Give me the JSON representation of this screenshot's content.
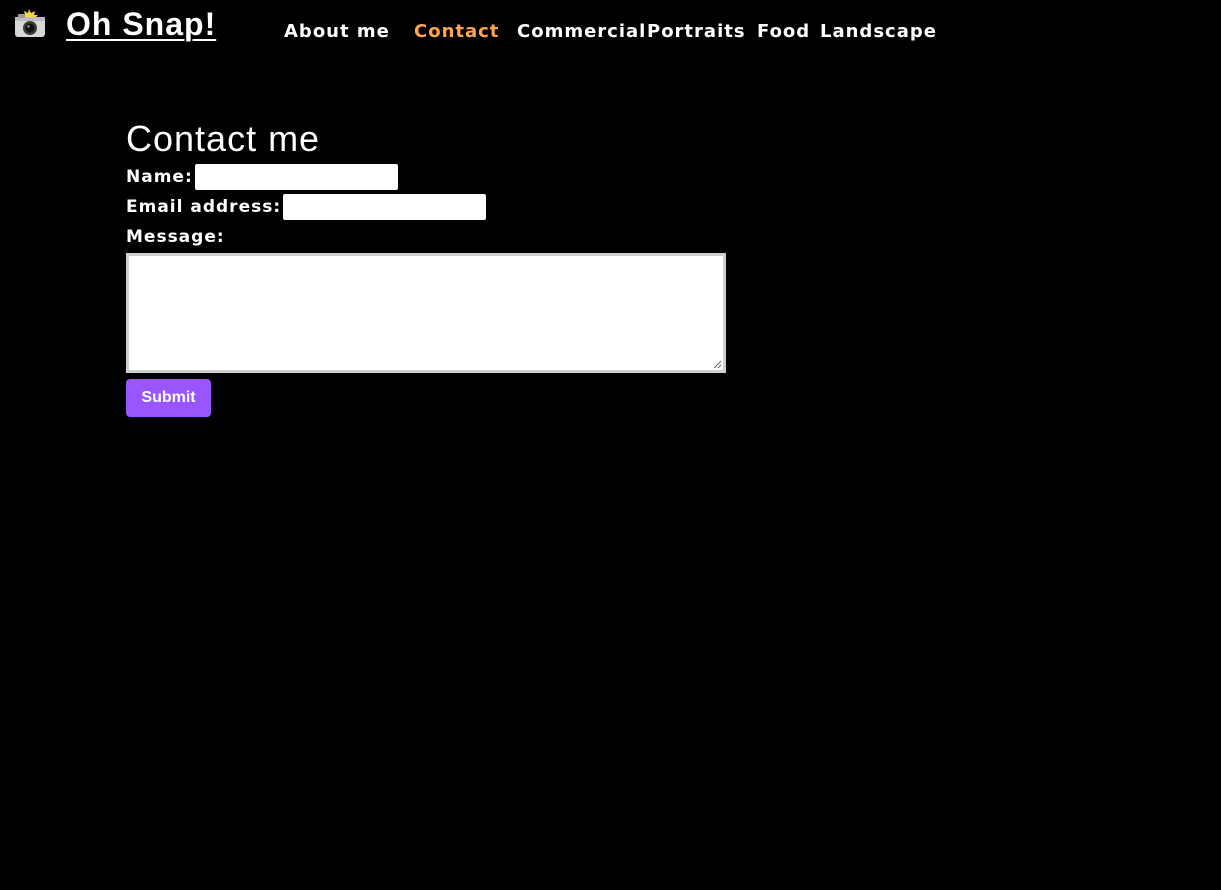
{
  "site": {
    "brand_icon": "camera-flash-icon",
    "brand_name": "Oh Snap!"
  },
  "nav": {
    "items": [
      {
        "label": "About me",
        "active": false
      },
      {
        "label": "Contact",
        "active": true
      },
      {
        "label": "Commercial",
        "active": false
      },
      {
        "label": "Portraits",
        "active": false
      },
      {
        "label": "Food",
        "active": false
      },
      {
        "label": "Landscape",
        "active": false
      }
    ]
  },
  "contact_form": {
    "title": "Contact me",
    "name_label": "Name:",
    "name_value": "",
    "email_label": "Email address:",
    "email_value": "",
    "message_label": "Message:",
    "message_value": "",
    "submit_label": "Submit"
  },
  "colors": {
    "background": "#000000",
    "text": "#ffffff",
    "nav_active": "#ffa64d",
    "submit_button": "#9955ff"
  }
}
